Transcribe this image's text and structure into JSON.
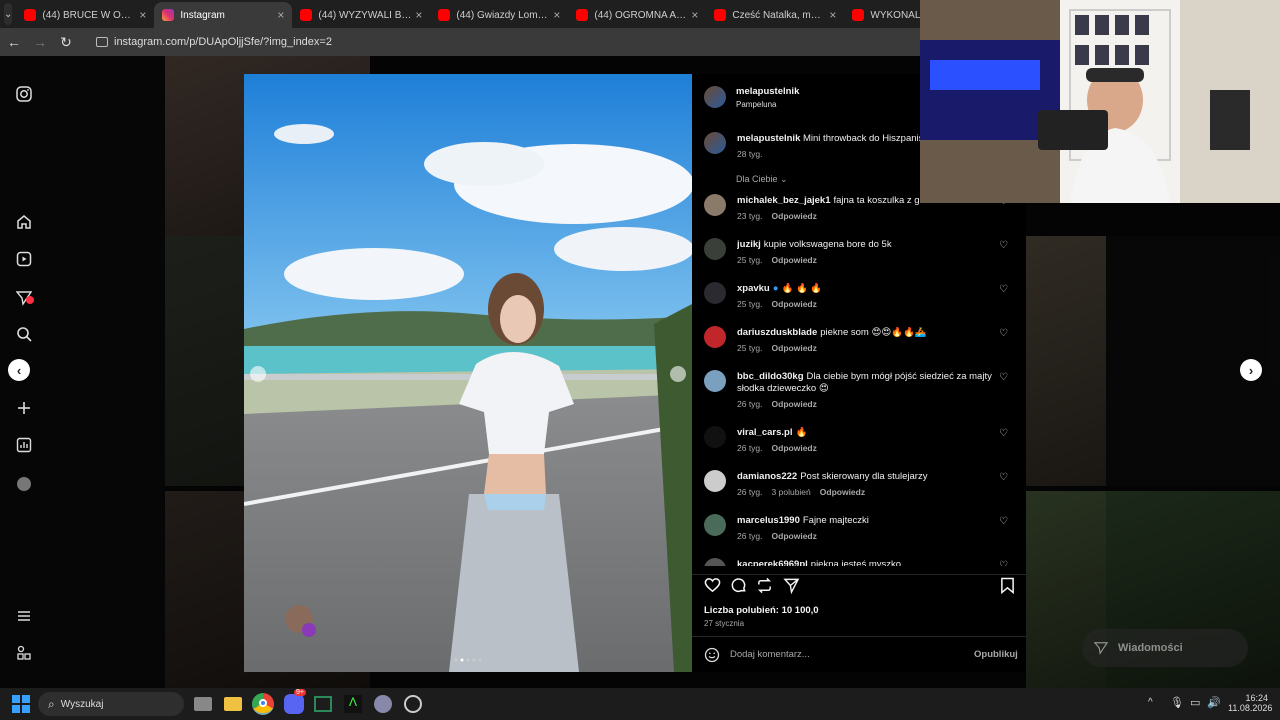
{
  "browser": {
    "tabs": [
      {
        "title": "(44) BRUCE W OPŁAKANE",
        "kind": "yt",
        "active": false
      },
      {
        "title": "Instagram",
        "kind": "ig",
        "active": true
      },
      {
        "title": "(44) WYZYWALI BUDDĘ N",
        "kind": "yt",
        "active": false
      },
      {
        "title": "(44) Gwiazdy Lombardu T",
        "kind": "yt",
        "active": false
      },
      {
        "title": "(44) OGROMNA AFERA F",
        "kind": "yt",
        "active": false
      },
      {
        "title": "Cześć Natalka, możesz wy",
        "kind": "yt",
        "active": false
      },
      {
        "title": "WYKONALI",
        "kind": "yt",
        "active": false
      }
    ],
    "url": "instagram.com/p/DUApOljjSfe/?img_index=2"
  },
  "post": {
    "author": "melapustelnik",
    "location": "Pampeluna",
    "caption_user": "melapustelnik",
    "caption_text": "Mini throwback do Hiszpanis",
    "caption_time": "28 tyg.",
    "filter_label": "Dla Ciebie",
    "likes_label": "Liczba polubień: 10 100,0",
    "date": "27 stycznia",
    "add_comment_placeholder": "Dodaj komentarz...",
    "publish_label": "Opublikuj"
  },
  "comments": [
    {
      "user": "michalek_bez_jajek1",
      "text": "fajna ta koszulka z guzikami",
      "time": "23 tyg.",
      "likes": "",
      "reply": "Odpowiedz",
      "avatar_color": "#8a7a6a"
    },
    {
      "user": "juzikj",
      "text": "kupie volkswagena bore do 5k",
      "time": "25 tyg.",
      "likes": "",
      "reply": "Odpowiedz",
      "avatar_color": "#3a3f3a"
    },
    {
      "user": "xpavku",
      "text": "🔥 🔥 🔥",
      "time": "25 tyg.",
      "likes": "",
      "reply": "Odpowiedz",
      "avatar_color": "#2a2a30",
      "verified": true
    },
    {
      "user": "dariuszduskblade",
      "text": "piekne som 😍😍🔥🔥🚣",
      "time": "25 tyg.",
      "likes": "",
      "reply": "Odpowiedz",
      "avatar_color": "#c0262a"
    },
    {
      "user": "bbc_dildo30kg",
      "text": "Dla ciebie bym mógł pójść siedzieć za majty",
      "text2": "słodka dzieweczko 😍",
      "time": "26 tyg.",
      "likes": "",
      "reply": "Odpowiedz",
      "avatar_color": "#7aa0c0"
    },
    {
      "user": "viral_cars.pl",
      "text": "🔥",
      "time": "26 tyg.",
      "likes": "",
      "reply": "Odpowiedz",
      "avatar_color": "#111111"
    },
    {
      "user": "damianos222",
      "text": "Post skierowany dla stulejarzy",
      "time": "26 tyg.",
      "likes": "3 polubień",
      "reply": "Odpowiedz",
      "avatar_color": "#cccccc"
    },
    {
      "user": "marcelus1990",
      "text": "Fajne majteczki",
      "time": "26 tyg.",
      "likes": "",
      "reply": "Odpowiedz",
      "avatar_color": "#4a6a5a"
    },
    {
      "user": "kacperek6969pl",
      "text": "piekna jesteś myszko",
      "time": "",
      "likes": "",
      "reply": "",
      "avatar_color": "#555555"
    }
  ],
  "ig_messages": {
    "label": "Wiadomości"
  },
  "taskbar": {
    "search_placeholder": "Wyszukaj",
    "time": "16:24",
    "date": "11.08.2026",
    "discord_badge": "9+"
  },
  "colors": {
    "instagram_bg": "#000000",
    "tab_active": "#3a3a3a",
    "taskbar": "#1c1c1c"
  }
}
